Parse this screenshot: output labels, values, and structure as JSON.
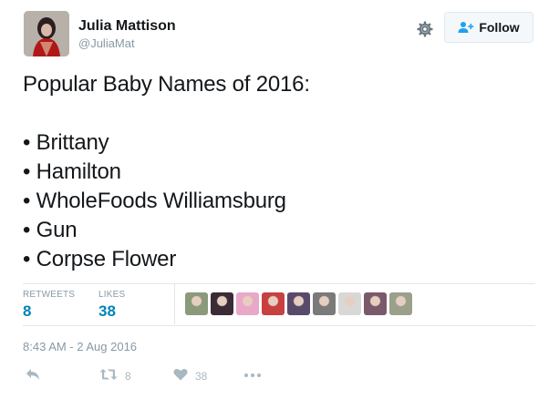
{
  "user": {
    "name": "Julia Mattison",
    "handle": "@JuliaMat"
  },
  "follow_button": {
    "label": "Follow"
  },
  "tweet": {
    "text": "Popular Baby Names of 2016:\n\n• Brittany\n• Hamilton\n• WholeFoods Williamsburg\n• Gun\n• Corpse Flower"
  },
  "stats": {
    "retweets_label": "RETWEETS",
    "retweets_count": "8",
    "likes_label": "LIKES",
    "likes_count": "38"
  },
  "liker_avatars": [
    {
      "color": "#8a9a7a"
    },
    {
      "color": "#3a2b35"
    },
    {
      "color": "#e9a8c8"
    },
    {
      "color": "#c94040"
    },
    {
      "color": "#5a4a6a"
    },
    {
      "color": "#7a7a7a"
    },
    {
      "color": "#d8d8d8"
    },
    {
      "color": "#7a5a6a"
    },
    {
      "color": "#9aa08a"
    }
  ],
  "timestamp": "8:43 AM - 2 Aug 2016",
  "actions": {
    "retweet_count": "8",
    "like_count": "38"
  },
  "colors": {
    "link_blue": "#0084b4",
    "muted": "#8899a6",
    "divider": "#e1e8ed",
    "icon_gray": "#aab8c2"
  }
}
